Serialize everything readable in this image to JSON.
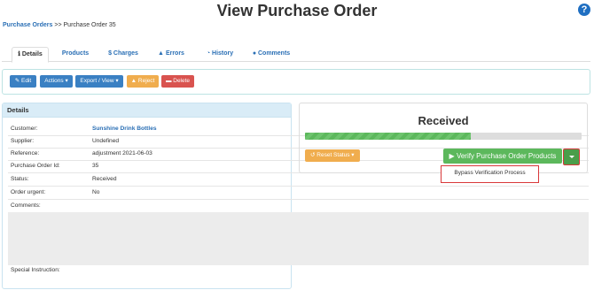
{
  "page": {
    "title": "View Purchase Order",
    "help_icon": "?"
  },
  "breadcrumb": {
    "root": "Purchase Orders",
    "sep": ">>",
    "current": "Purchase Order 35"
  },
  "tabs": [
    {
      "label": "Details",
      "icon": "info-icon",
      "active": true
    },
    {
      "label": "Products",
      "icon": "",
      "active": false
    },
    {
      "label": "Charges",
      "icon": "dollar-icon",
      "active": false
    },
    {
      "label": "Errors",
      "icon": "warning-icon",
      "active": false
    },
    {
      "label": "History",
      "icon": "clock-icon",
      "active": false
    },
    {
      "label": "Comments",
      "icon": "comment-icon",
      "active": false
    }
  ],
  "toolbar": {
    "edit": "Edit",
    "actions": "Actions",
    "export": "Export / View",
    "reject": "Reject",
    "delete": "Delete",
    "colors": {
      "blue": "#3a80c3",
      "orange": "#f0ad4e",
      "red": "#d9534f"
    }
  },
  "details": {
    "heading": "Details",
    "rows": [
      {
        "label": "Customer:",
        "value": "Sunshine Drink Bottles"
      },
      {
        "label": "Supplier:",
        "value": "Undefined"
      },
      {
        "label": "Reference:",
        "value": "adjustment 2021-06-03"
      },
      {
        "label": "Purchase Order Id:",
        "value": "35"
      },
      {
        "label": "Status:",
        "value": "Received"
      },
      {
        "label": "Order urgent:",
        "value": "No"
      },
      {
        "label": "Comments:",
        "value": ""
      }
    ],
    "special_instruction_label": "Special Instruction:"
  },
  "status_panel": {
    "status": "Received",
    "progress_fraction": 0.6,
    "reset_label": "Reset Status",
    "verify_label": "Verify Purchase Order Products",
    "dropdown_item": "Bypass Verification Process",
    "accent_green": "#5cb85c"
  }
}
